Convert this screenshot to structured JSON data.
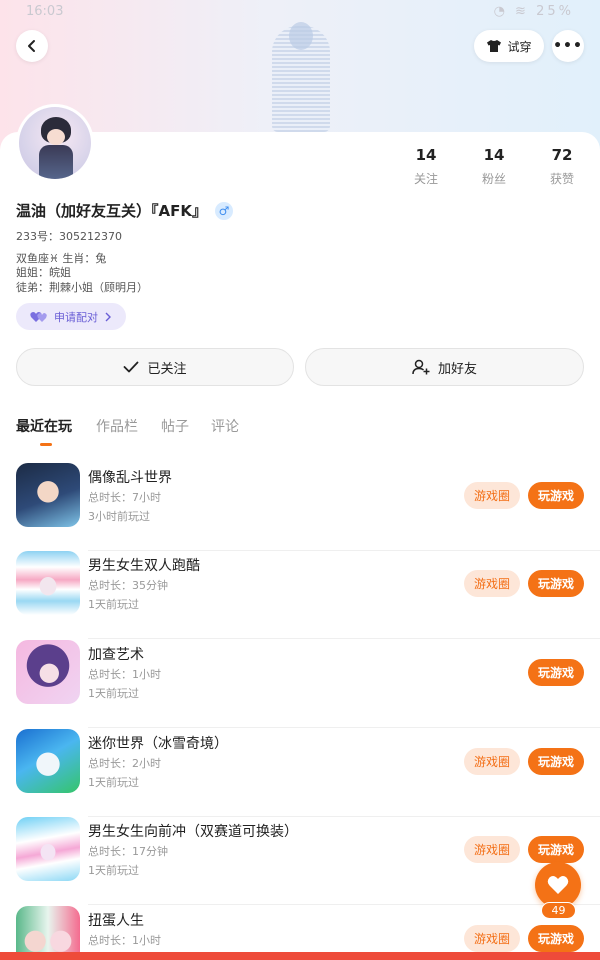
{
  "status_bar": {
    "time": "16:03",
    "battery": "25%"
  },
  "header": {
    "try_on_label": "试穿"
  },
  "profile": {
    "name": "温油（加好友互关）『AFK』",
    "gender_symbol": "♂",
    "uid": "233号：305212370",
    "zodiac_line": "双鱼座♓ 生肖：兔",
    "sister_line": "姐姐：皖姐",
    "apprentice_line": "徒弟：荆棘小姐（顾明月）",
    "pair_label": "申请配对",
    "stats": [
      {
        "value": "14",
        "label": "关注"
      },
      {
        "value": "14",
        "label": "粉丝"
      },
      {
        "value": "72",
        "label": "获赞"
      }
    ]
  },
  "actions": {
    "followed_label": "已关注",
    "add_friend_label": "加好友"
  },
  "tabs": [
    {
      "label": "最近在玩",
      "active": true
    },
    {
      "label": "作品栏",
      "active": false
    },
    {
      "label": "帖子",
      "active": false
    },
    {
      "label": "评论",
      "active": false
    }
  ],
  "games": [
    {
      "title": "偶像乱斗世界",
      "duration": "总时长：7小时",
      "last_played": "3小时前玩过",
      "has_circle": true
    },
    {
      "title": "男生女生双人跑酷",
      "duration": "总时长：35分钟",
      "last_played": "1天前玩过",
      "has_circle": true
    },
    {
      "title": "加查艺术",
      "duration": "总时长：1小时",
      "last_played": "1天前玩过",
      "has_circle": false
    },
    {
      "title": "迷你世界（冰雪奇境）",
      "duration": "总时长：2小时",
      "last_played": "1天前玩过",
      "has_circle": true
    },
    {
      "title": "男生女生向前冲（双赛道可换装）",
      "duration": "总时长：17分钟",
      "last_played": "1天前玩过",
      "has_circle": true
    },
    {
      "title": "扭蛋人生",
      "duration": "总时长：1小时",
      "last_played": "",
      "has_circle": true
    }
  ],
  "game_buttons": {
    "circle_label": "游戏圈",
    "play_label": "玩游戏"
  },
  "like": {
    "count": "49"
  },
  "colors": {
    "accent": "#f47216",
    "accent_light": "#fde6d8",
    "pair_purple": "#6a5fd6"
  }
}
